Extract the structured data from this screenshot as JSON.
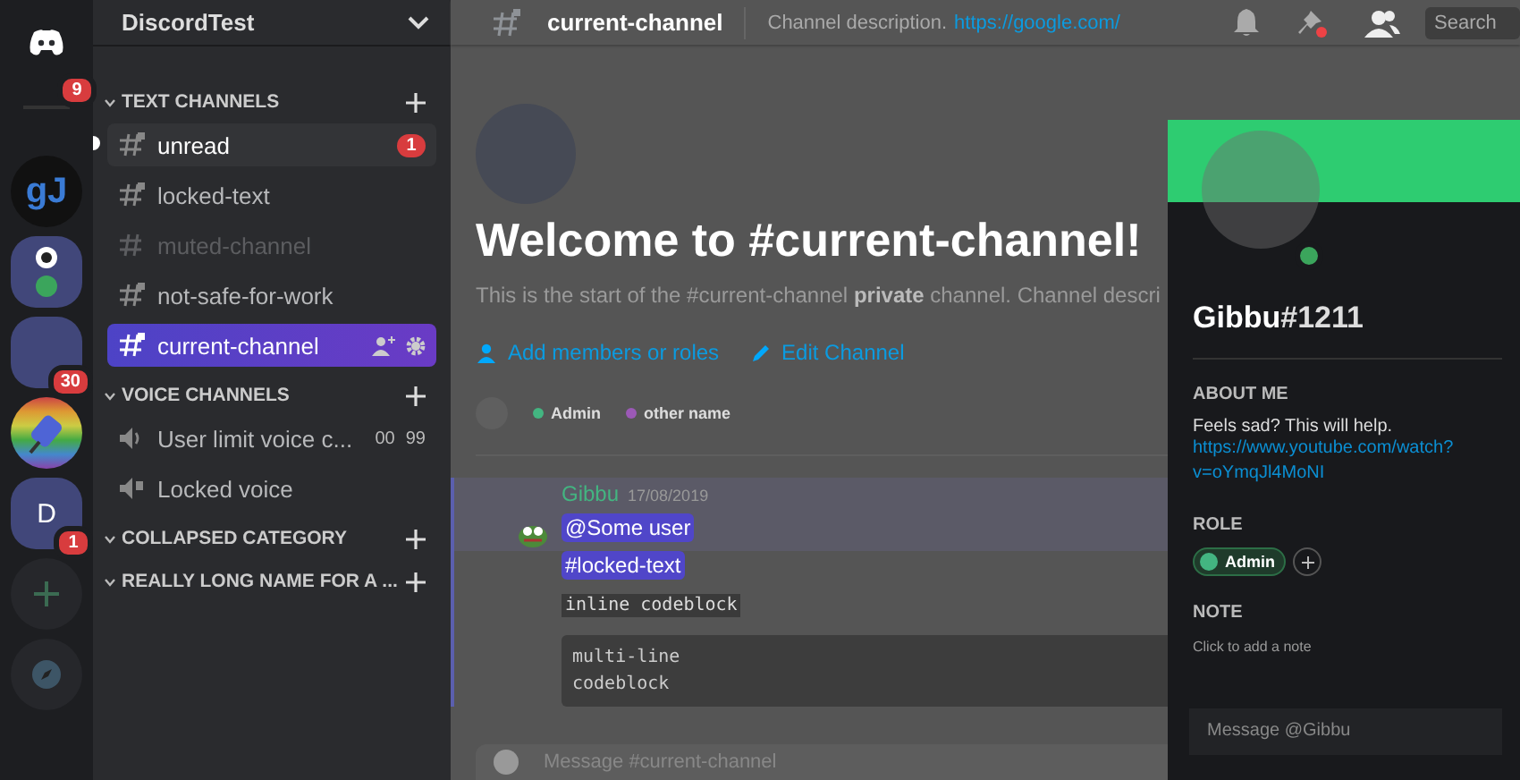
{
  "servers": [
    {
      "kind": "home",
      "badge": "9"
    },
    {
      "kind": "logo",
      "label": "gJ"
    },
    {
      "kind": "folder"
    },
    {
      "kind": "blank",
      "badge": "30"
    },
    {
      "kind": "plug"
    },
    {
      "kind": "letter",
      "label": "D",
      "badge": "1"
    },
    {
      "kind": "add"
    },
    {
      "kind": "explore"
    }
  ],
  "guild": {
    "name": "DiscordTest"
  },
  "categories": [
    {
      "name": "TEXT CHANNELS",
      "channels": [
        {
          "kind": "text",
          "name": "unread",
          "locked": true,
          "unread": true,
          "muted": false,
          "selected": false,
          "badge": "1"
        },
        {
          "kind": "text",
          "name": "locked-text",
          "locked": true,
          "unread": false,
          "muted": false,
          "selected": false
        },
        {
          "kind": "text",
          "name": "muted-channel",
          "locked": false,
          "unread": false,
          "muted": true,
          "selected": false
        },
        {
          "kind": "text",
          "name": "not-safe-for-work",
          "locked": true,
          "unread": false,
          "muted": false,
          "selected": false
        },
        {
          "kind": "text",
          "name": "current-channel",
          "locked": true,
          "unread": false,
          "muted": false,
          "selected": true
        }
      ]
    },
    {
      "name": "VOICE CHANNELS",
      "channels": [
        {
          "kind": "voice",
          "name": "User limit voice c...",
          "locked": false,
          "unread": false,
          "muted": false,
          "selected": false,
          "count": "00",
          "limit": "99"
        },
        {
          "kind": "voice",
          "name": "Locked voice",
          "locked": true,
          "unread": false,
          "muted": false,
          "selected": false
        }
      ]
    },
    {
      "name": "COLLAPSED CATEGORY"
    },
    {
      "name": "REALLY LONG NAME FOR A ..."
    }
  ],
  "header": {
    "channel": "current-channel",
    "description": "Channel description.",
    "link": "https://google.com/",
    "search_placeholder": "Search"
  },
  "welcome": {
    "title": "Welcome to #current-channel!",
    "text": "This is the start of the #current-channel **private** channel. Channel descri",
    "actions": [
      "Add members or roles",
      "Edit Channel"
    ],
    "roles": [
      {
        "name": "Admin",
        "color": "#43b581"
      },
      {
        "name": "other name",
        "color": "#9b59b6"
      }
    ]
  },
  "message": {
    "author": "Gibbu",
    "date": "17/08/2019",
    "mention": "@Some user",
    "channel_mention": "#locked-text",
    "inline_code": "inline codeblock",
    "codeblock": [
      "multi-line",
      "codeblock"
    ]
  },
  "composer": {
    "placeholder": "Message #current-channel"
  },
  "profile": {
    "name": "Gibbu",
    "tag": "#1211",
    "about_heading": "ABOUT ME",
    "about": "Feels sad? This will help.",
    "about_link": "https://www.youtube.com/watch?v=oYmqJl4MoNI",
    "role_heading": "ROLE",
    "roles": [
      {
        "name": "Admin",
        "color": "#43b581"
      }
    ],
    "note_heading": "NOTE",
    "note_placeholder": "Click to add a note",
    "message_placeholder": "Message @Gibbu"
  }
}
